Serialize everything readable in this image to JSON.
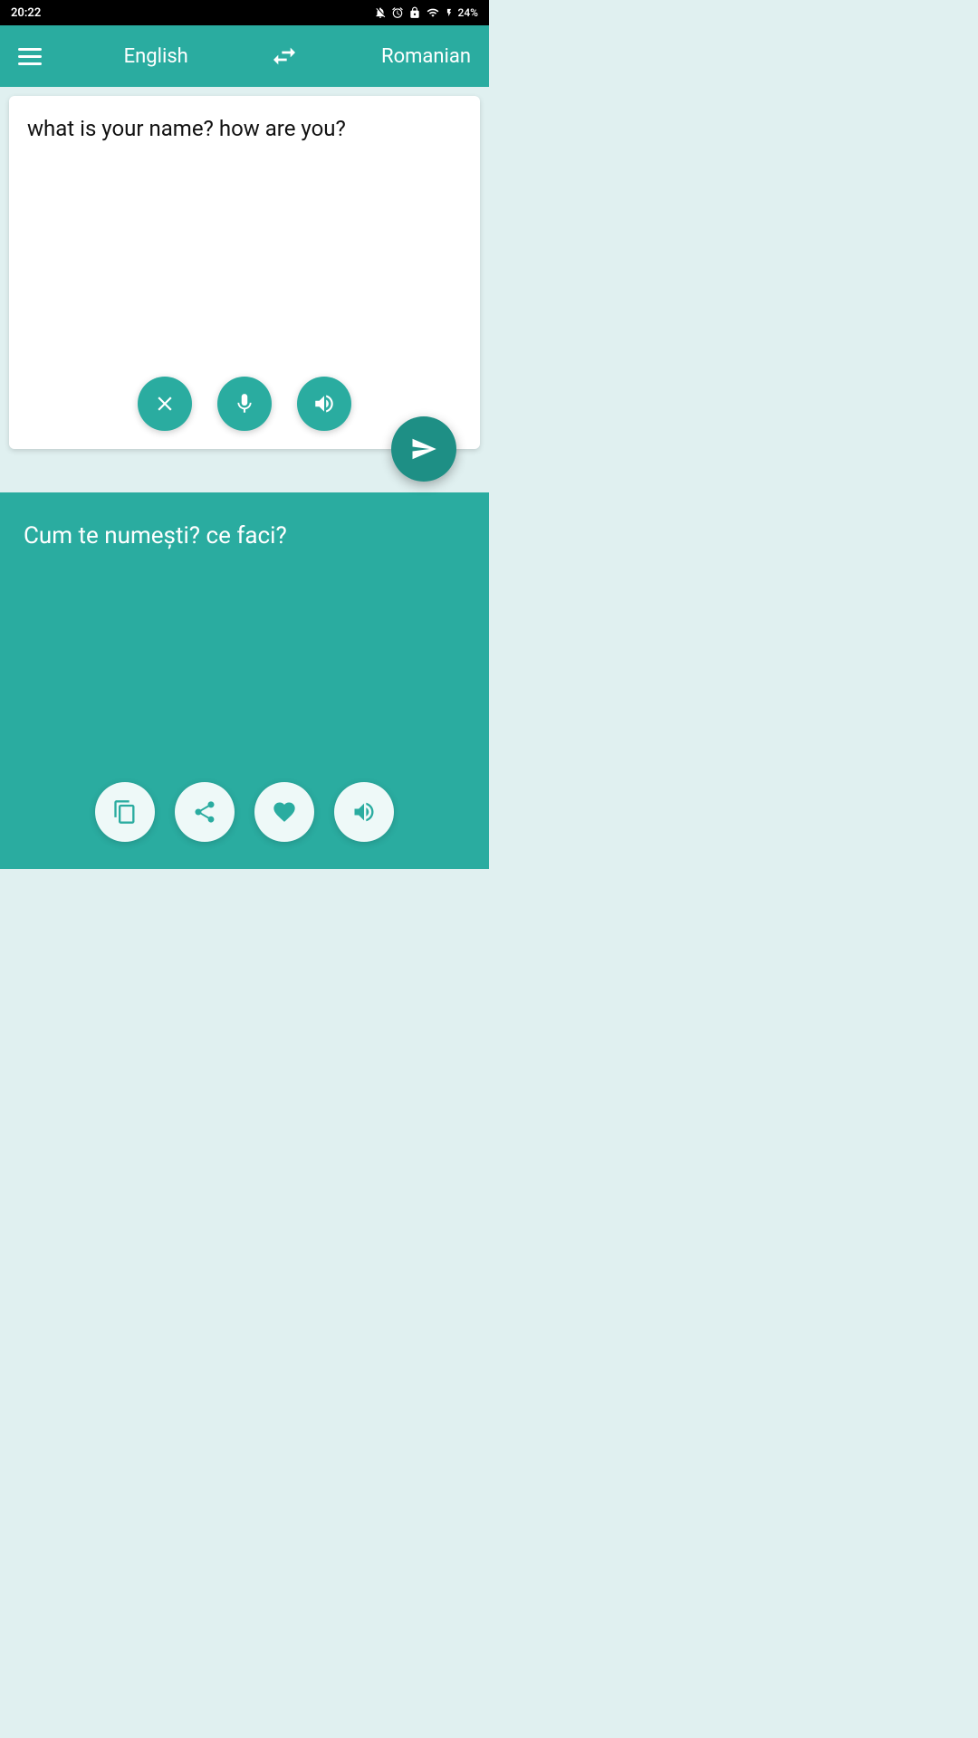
{
  "statusBar": {
    "time": "20:22",
    "battery": "24%"
  },
  "toolbar": {
    "sourceLanguage": "English",
    "targetLanguage": "Romanian",
    "swapIcon": "swap-icon",
    "menuIcon": "hamburger-icon"
  },
  "inputPanel": {
    "text": "what is your name? how are you?",
    "clearLabel": "clear-button",
    "micLabel": "microphone-button",
    "speakerLabel": "speaker-button"
  },
  "fab": {
    "label": "translate-button"
  },
  "outputPanel": {
    "text": "Cum te numești? ce faci?",
    "copyLabel": "copy-button",
    "shareLabel": "share-button",
    "favoriteLabel": "favorite-button",
    "speakerLabel": "tts-button"
  },
  "colors": {
    "teal": "#2aaca0",
    "darkTeal": "#1e8f85",
    "white": "#ffffff"
  }
}
